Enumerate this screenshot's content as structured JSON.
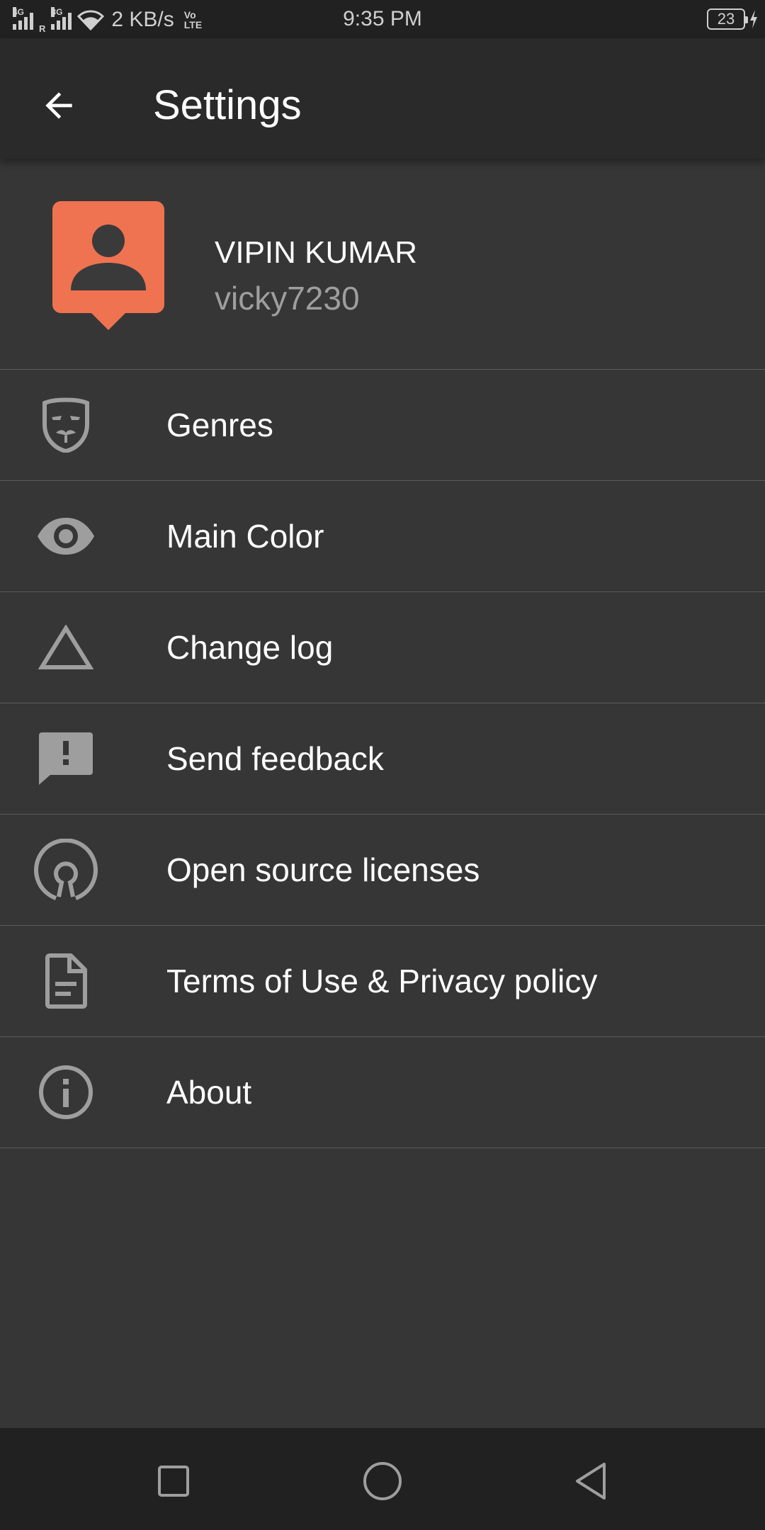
{
  "status_bar": {
    "network_1": "4G",
    "network_2": "3G",
    "roaming": "R",
    "speed": "2 KB/s",
    "volte_line1": "Vo",
    "volte_line2": "LTE",
    "time": "9:35 PM",
    "battery": "23"
  },
  "app_bar": {
    "title": "Settings"
  },
  "profile": {
    "name": "VIPIN KUMAR",
    "username": "vicky7230",
    "avatar_color": "#EF7350"
  },
  "menu": {
    "items": [
      {
        "label": "Genres",
        "icon": "mask-icon"
      },
      {
        "label": "Main Color",
        "icon": "eye-icon"
      },
      {
        "label": "Change log",
        "icon": "triangle-icon"
      },
      {
        "label": "Send feedback",
        "icon": "feedback-icon"
      },
      {
        "label": "Open source licenses",
        "icon": "open-source-icon"
      },
      {
        "label": "Terms of Use & Privacy policy",
        "icon": "document-icon"
      },
      {
        "label": "About",
        "icon": "info-icon"
      }
    ]
  },
  "theme": {
    "background": "#363636",
    "app_bar": "#2A2A2A",
    "status_bar": "#212121",
    "icon_color": "#9E9E9E",
    "divider": "#5A5A5A"
  }
}
